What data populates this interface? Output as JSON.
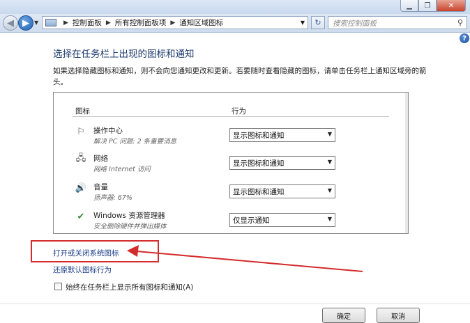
{
  "window": {
    "controls": {
      "minimize": "▁",
      "maximize": "❐",
      "close": "✕"
    }
  },
  "nav": {
    "address": {
      "crumbs": [
        "控制面板",
        "所有控制面板项",
        "通知区域图标"
      ]
    },
    "search": {
      "placeholder": "搜索控制面板"
    }
  },
  "page": {
    "title": "选择在任务栏上出现的图标和通知",
    "description": "如果选择隐藏图标和通知，则不会向您通知更改和更新。若要随时查看隐藏的图标，请单击任务栏上通知区域旁的箭头。"
  },
  "table": {
    "headers": {
      "icon": "图标",
      "behavior": "行为"
    },
    "rows": [
      {
        "icon": "flag-icon",
        "name": "操作中心",
        "sub": "解决 PC 问题: 2 条重要消息",
        "behavior": "显示图标和通知"
      },
      {
        "icon": "network-icon",
        "name": "网络",
        "sub": "网络 Internet 访问",
        "behavior": "显示图标和通知"
      },
      {
        "icon": "speaker-icon",
        "name": "音量",
        "sub": "扬声器: 67%",
        "behavior": "显示图标和通知"
      },
      {
        "icon": "safely-remove-icon",
        "name": "Windows 资源管理器",
        "sub": "安全删除硬件并弹出媒体",
        "behavior": "仅显示通知"
      }
    ]
  },
  "links": {
    "system_icons": "打开或关闭系统图标",
    "restore_defaults": "还原默认图标行为"
  },
  "checkbox": {
    "label": "始终在任务栏上显示所有图标和通知(A)",
    "checked": false
  },
  "buttons": {
    "ok": "确定",
    "cancel": "取消"
  },
  "annotation": {
    "color": "#d42b2b"
  }
}
